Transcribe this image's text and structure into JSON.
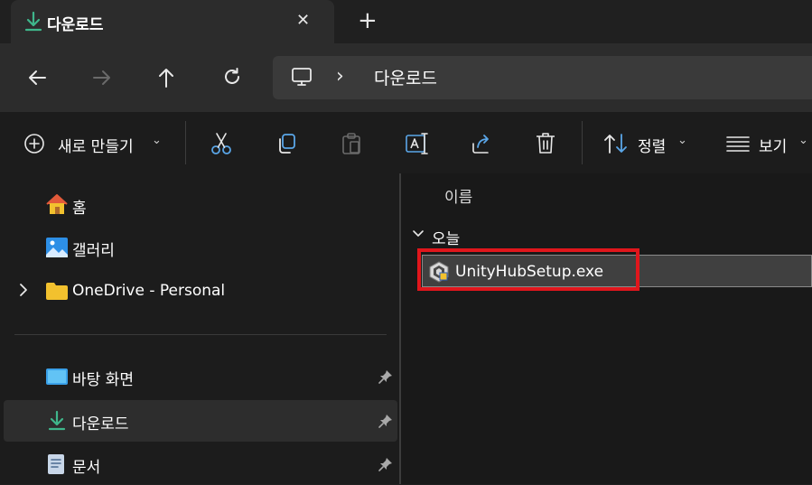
{
  "tab": {
    "title": "다운로드",
    "close_glyph": "✕",
    "new_tab_glyph": "+"
  },
  "address": {
    "location": "다운로드",
    "separator": "›"
  },
  "toolbar": {
    "new_label": "새로 만들기",
    "sort_label": "정렬",
    "view_label": "보기"
  },
  "sidebar": {
    "home": "홈",
    "gallery": "갤러리",
    "onedrive": "OneDrive - Personal",
    "desktop": "바탕 화면",
    "downloads": "다운로드",
    "documents": "문서"
  },
  "content": {
    "column_name": "이름",
    "group_today": "오늘",
    "file": "UnityHubSetup.exe"
  },
  "colors": {
    "accent_green": "#3fb68b",
    "highlight_red": "#e0161c",
    "folder_yellow": "#f2c12e"
  }
}
